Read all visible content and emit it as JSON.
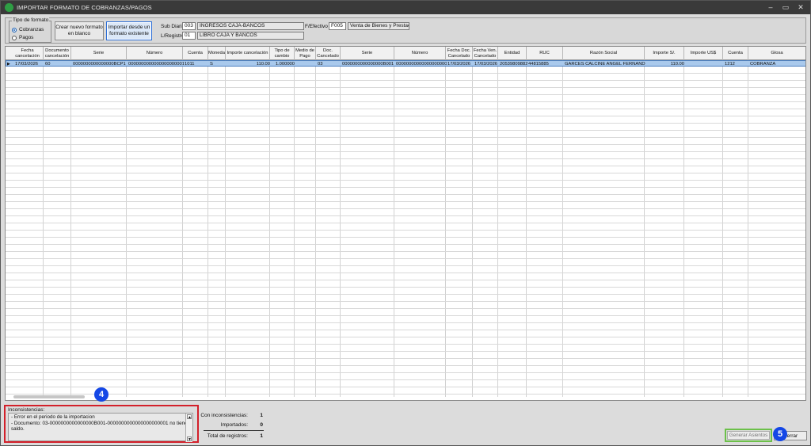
{
  "window": {
    "title": "IMPORTAR FORMATO DE COBRANZAS/PAGOS"
  },
  "format_type": {
    "legend": "Tipo de formato",
    "options": [
      {
        "label": "Cobranzas",
        "selected": true
      },
      {
        "label": "Pagos",
        "selected": false
      }
    ]
  },
  "buttons": {
    "new_format": "Crear nuevo formato en blanco",
    "import_existing": "Importar desde un formato existente",
    "generate": "Generar Asientos",
    "close": "Cerrar"
  },
  "header": {
    "sub_diario_label": "Sub Diario",
    "sub_diario_code": "003",
    "sub_diario_name": "INGRESOS CAJA-BANCOS",
    "lregistro_label": "L/Registro",
    "lregistro_code": "01",
    "lregistro_name": "LIBRO CAJA Y BANCOS",
    "fefectivo_label": "F/Efectivo",
    "fefectivo_code": "F005",
    "fefectivo_name": "Venta de Bienes y Prestació"
  },
  "table": {
    "columns": [
      "Fecha cancelación",
      "Documento cancelación",
      "Serie",
      "Número",
      "Cuenta",
      "Moneda",
      "Importe cancelación",
      "Tipo de cambio",
      "Medio de Pago",
      "Doc. Cancelado",
      "Serie",
      "Número",
      "Fecha Doc. Cancelado",
      "Fecha Ven. Cancelado",
      "Entidad",
      "RUC",
      "Razón Social",
      "Importe S/.",
      "Importe US$",
      "Cuenta",
      "Glosa"
    ],
    "rows": [
      [
        "17/03/2026",
        "60",
        "0000000000000000BCP1",
        "0000000000000000000001",
        "1011",
        "S",
        "110.00",
        "1.000000",
        "",
        "03",
        "0000000000000000B001",
        "0000000000000000000001",
        "17/03/2026",
        "17/03/2026",
        "20539809882",
        "44815885",
        "GARCES CALCINE ANGEL FERNANDO",
        "110.00",
        "",
        "1212",
        "COBRANZA"
      ]
    ]
  },
  "inconsistencies": {
    "title": "Inconsistencias:",
    "lines": [
      "- Error en el periodo de la importacion",
      "- Documento: 03-0000000000000000B001-0000000000000000000001 no tiene saldo."
    ]
  },
  "stats": {
    "with_inconsistencies_label": "Con inconsistencias:",
    "with_inconsistencies": "1",
    "imported_label": "Importados:",
    "imported": "0",
    "total_label": "Total de registros:",
    "total": "1"
  },
  "markers": {
    "m4": "4",
    "m5": "5"
  },
  "colors": {
    "highlight_red": "#d3202a",
    "highlight_green": "#6cc04a",
    "marker_blue": "#1447e6",
    "row_selected": "#a9c9ec"
  }
}
